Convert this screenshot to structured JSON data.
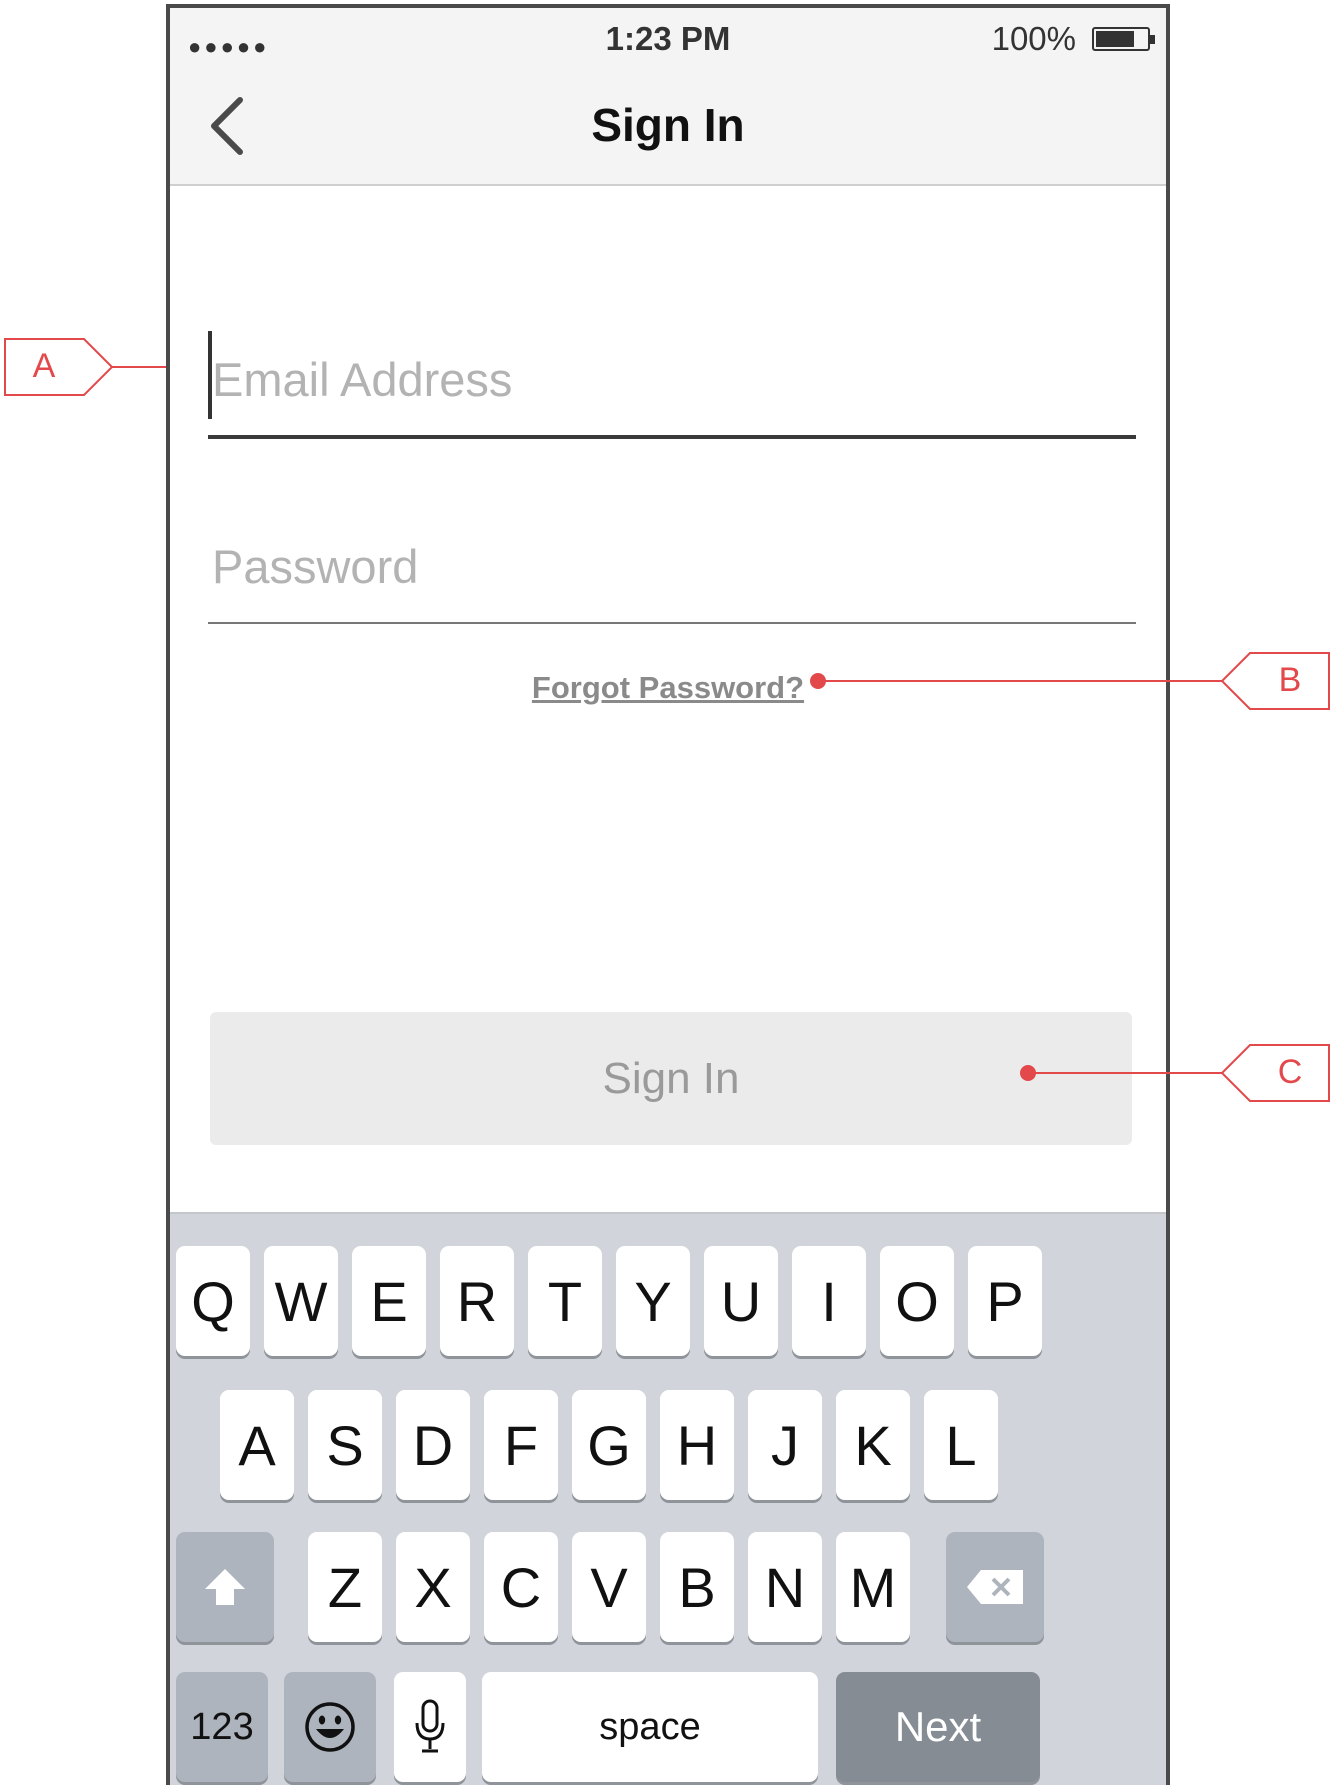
{
  "status_bar": {
    "signal": "●●●●●",
    "time": "1:23 PM",
    "battery_percent": "100%"
  },
  "nav": {
    "title": "Sign In",
    "back_icon": "chevron-left-icon"
  },
  "form": {
    "email_placeholder": "Email Address",
    "password_placeholder": "Password",
    "forgot_password": "Forgot Password?",
    "sign_in_button": "Sign In"
  },
  "keyboard": {
    "row1": [
      "Q",
      "W",
      "E",
      "R",
      "T",
      "Y",
      "U",
      "I",
      "O",
      "P"
    ],
    "row2": [
      "A",
      "S",
      "D",
      "F",
      "G",
      "H",
      "J",
      "K",
      "L"
    ],
    "row3": [
      "Z",
      "X",
      "C",
      "V",
      "B",
      "N",
      "M"
    ],
    "numbers_key": "123",
    "space_key": "space",
    "next_key": "Next",
    "shift_icon": "shift-arrow-icon",
    "delete_icon": "backspace-icon",
    "emoji_icon": "emoji-icon",
    "mic_icon": "microphone-icon"
  },
  "annotations": {
    "a": "A",
    "b": "B",
    "c": "C"
  },
  "colors": {
    "annotation": "#e3494b",
    "keyboard_bg": "#d1d5db",
    "next_key": "#868c94"
  }
}
